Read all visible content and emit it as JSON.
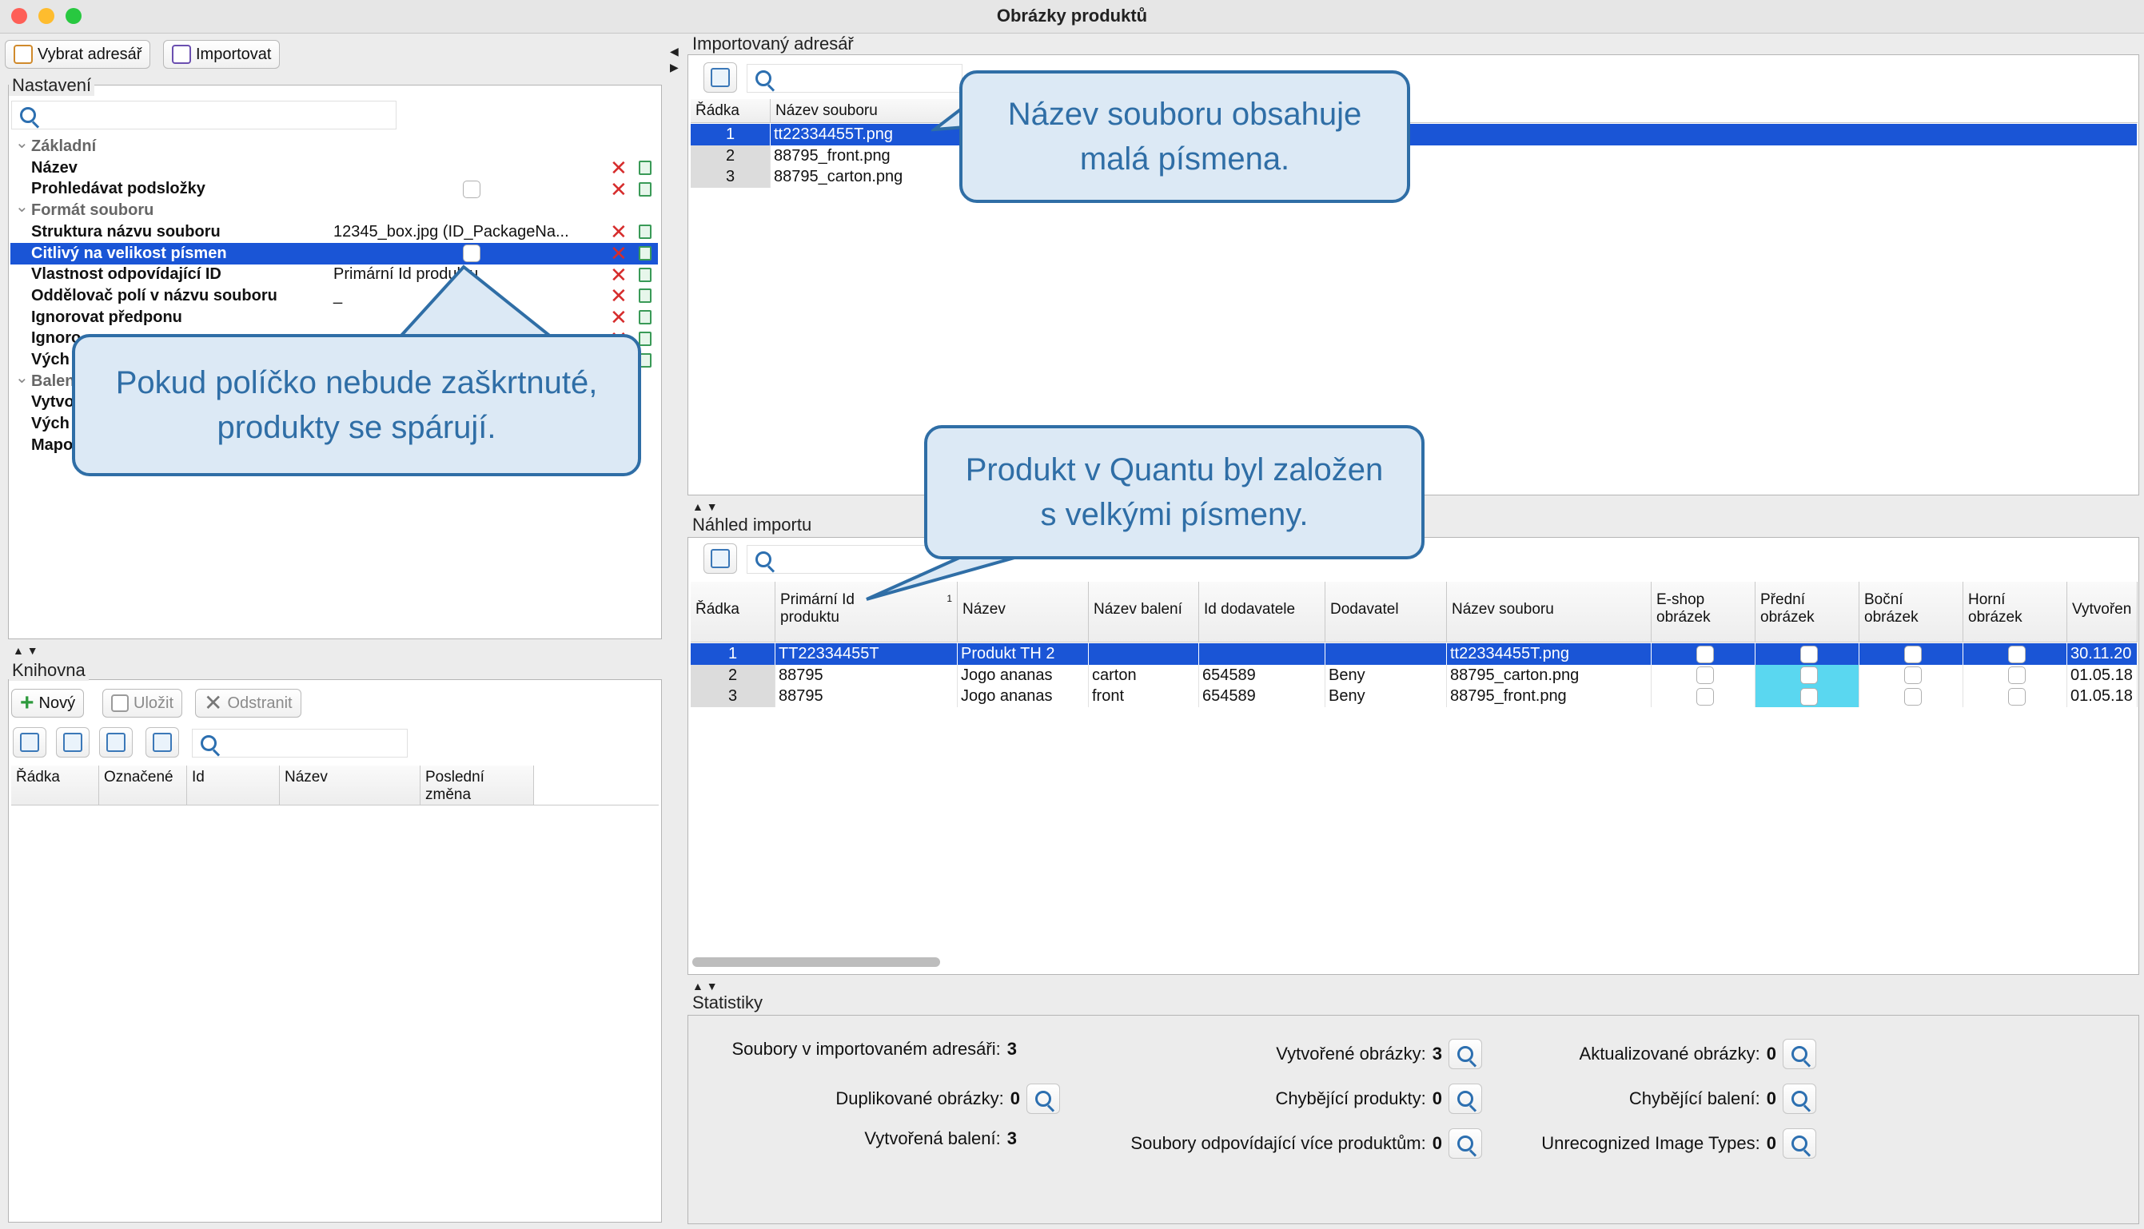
{
  "window": {
    "title": "Obrázky produktů"
  },
  "toolbar": {
    "select_dir": "Vybrat adresář",
    "import": "Importovat"
  },
  "settings": {
    "legend": "Nastavení",
    "search_placeholder": "",
    "rows": [
      {
        "type": "cat",
        "key": "Základní",
        "value": ""
      },
      {
        "type": "prop",
        "key": "Název",
        "value": ""
      },
      {
        "type": "prop",
        "key": "Prohledávat podsložky",
        "value": "",
        "checkbox": true
      },
      {
        "type": "cat",
        "key": "Formát souboru",
        "value": ""
      },
      {
        "type": "prop",
        "key": "Struktura názvu souboru",
        "value": "12345_box.jpg (ID_PackageNa..."
      },
      {
        "type": "prop",
        "key": "Citlivý na velikost písmen",
        "value": "",
        "checkbox": true,
        "selected": true
      },
      {
        "type": "prop",
        "key": "Vlastnost odpovídající ID",
        "value": "Primární Id produktu"
      },
      {
        "type": "prop",
        "key": "Oddělovač polí v názvu souboru",
        "value": "_"
      },
      {
        "type": "prop",
        "key": "Ignorovat předponu",
        "value": ""
      },
      {
        "type": "prop",
        "key": "Ignoro",
        "value": ""
      },
      {
        "type": "prop",
        "key": "Vých",
        "value": ""
      },
      {
        "type": "cat",
        "key": "Balen",
        "value": ""
      },
      {
        "type": "prop",
        "key": "Vytvo",
        "value": ""
      },
      {
        "type": "prop",
        "key": "Vých",
        "value": ""
      },
      {
        "type": "prop",
        "key": "Mapo",
        "value": ""
      }
    ]
  },
  "library": {
    "legend": "Knihovna",
    "new": "Nový",
    "save": "Uložit",
    "delete": "Odstranit",
    "columns": [
      "Řádka",
      "Označené",
      "Id",
      "Název",
      "Poslední změna"
    ]
  },
  "imported_dir": {
    "legend": "Importovaný adresář",
    "columns": [
      "Řádka",
      "Název souboru"
    ],
    "sort_index": "1",
    "rows": [
      {
        "n": "1",
        "file": "tt22334455T.png"
      },
      {
        "n": "2",
        "file": "88795_front.png"
      },
      {
        "n": "3",
        "file": "88795_carton.png"
      }
    ]
  },
  "preview": {
    "legend": "Náhled importu",
    "sort_index": "1",
    "columns": [
      "Řádka",
      "Primární Id produktu",
      "Název",
      "Název balení",
      "Id dodavatele",
      "Dodavatel",
      "Název souboru",
      "E-shop obrázek",
      "Přední obrázek",
      "Boční obrázek",
      "Horní obrázek",
      "Vytvořen"
    ],
    "rows": [
      {
        "n": "1",
        "pid": "TT22334455T",
        "name": "Produkt TH 2",
        "pack": "",
        "supid": "",
        "supplier": "",
        "file": "tt22334455T.png",
        "created": "30.11.20"
      },
      {
        "n": "2",
        "pid": "88795",
        "name": "Jogo ananas",
        "pack": "carton",
        "supid": "654589",
        "supplier": "Beny",
        "file": "88795_carton.png",
        "created": "01.05.18"
      },
      {
        "n": "3",
        "pid": "88795",
        "name": "Jogo ananas",
        "pack": "front",
        "supid": "654589",
        "supplier": "Beny",
        "file": "88795_front.png",
        "created": "01.05.18"
      }
    ]
  },
  "stats": {
    "legend": "Statistiky",
    "items": [
      {
        "label": "Soubory v importovaném adresáři:",
        "value": "3"
      },
      {
        "label": "Vytvořené obrázky:",
        "value": "3"
      },
      {
        "label": "Aktualizované obrázky:",
        "value": "0"
      },
      {
        "label": "Duplikované obrázky:",
        "value": "0"
      },
      {
        "label": "Chybějící produkty:",
        "value": "0"
      },
      {
        "label": "Chybějící balení:",
        "value": "0"
      },
      {
        "label": "Vytvořená balení:",
        "value": "3"
      },
      {
        "label": "Soubory odpovídající více produktům:",
        "value": "0"
      },
      {
        "label": "Unrecognized Image Types:",
        "value": "0"
      }
    ]
  },
  "callouts": {
    "checkbox_note": "Pokud políčko nebude zaškrtnuté, produkty se spárují.",
    "lowercase_note": "Název souboru obsahuje malá písmena.",
    "uppercase_note": "Produkt v Quantu byl založen s velkými písmeny."
  },
  "colors": {
    "selection": "#1a55d6",
    "callout_fill": "#dce9f5",
    "callout_border": "#2f6ea6",
    "highlight": "#5ad7f0"
  }
}
